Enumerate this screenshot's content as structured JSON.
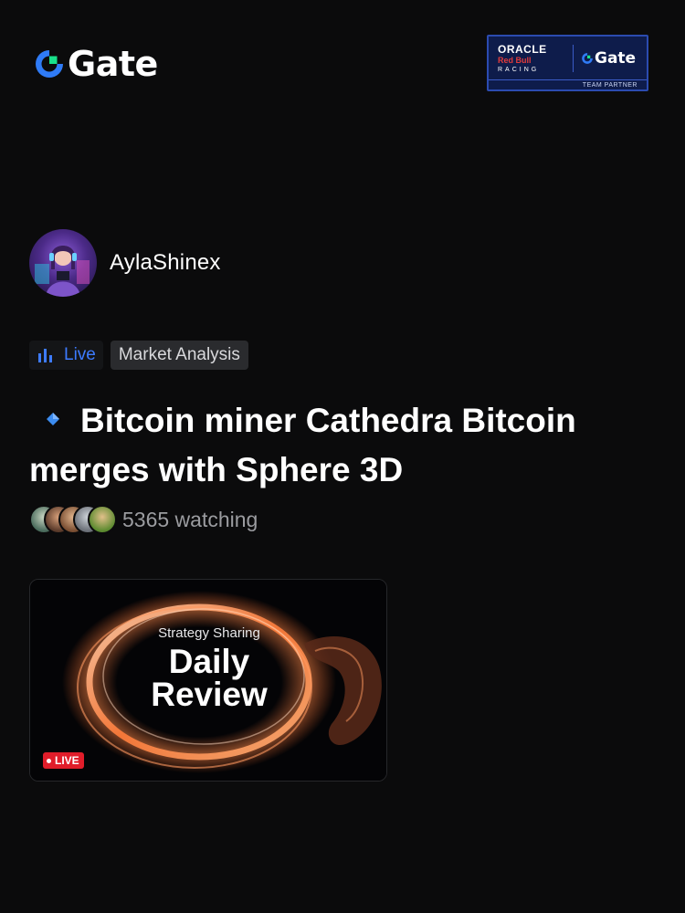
{
  "brand": {
    "name": "Gate",
    "accent": "#2f7bf6",
    "background": "#0b0b0c"
  },
  "partner_badge": {
    "line1": "ORACLE",
    "line2": "Red Bull",
    "line3": "RACING",
    "brand": "Gate",
    "caption": "TEAM PARTNER"
  },
  "author": {
    "name": "AylaShinex"
  },
  "tags": {
    "live_label": "Live",
    "category": "Market Analysis",
    "live_color": "#3d7bff"
  },
  "post": {
    "title": "Bitcoin miner Cathedra Bitcoin merges with Sphere 3D"
  },
  "audience": {
    "watching": "5365 watching"
  },
  "video": {
    "subtitle": "Strategy Sharing",
    "title_line1": "Daily",
    "title_line2": "Review",
    "live_badge": "LIVE",
    "live_color": "#e11d2a"
  }
}
